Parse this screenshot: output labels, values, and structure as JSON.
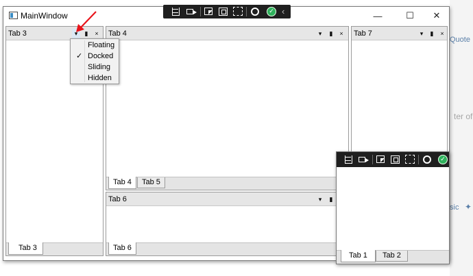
{
  "window": {
    "title": "MainWindow",
    "minimize": "—",
    "maximize": "☐",
    "close": "✕"
  },
  "background": {
    "text_quote": "Quote",
    "text_ter_of": "ter of",
    "text_sic": "sic"
  },
  "panes": {
    "left": {
      "title": "Tab 3",
      "tabs": [
        "Tab 3"
      ]
    },
    "center_top": {
      "title": "Tab 4",
      "tabs": [
        "Tab 4",
        "Tab 5"
      ]
    },
    "center_bottom": {
      "title": "Tab 6",
      "tabs": [
        "Tab 6"
      ]
    },
    "right": {
      "title": "Tab 7"
    },
    "floating": {
      "tabs": [
        "Tab 1",
        "Tab 2"
      ]
    }
  },
  "pane_buttons": {
    "dropdown": "▾",
    "pin": "📌",
    "close": "×"
  },
  "context_menu": {
    "items": [
      {
        "label": "Floating",
        "checked": false
      },
      {
        "label": "Docked",
        "checked": true
      },
      {
        "label": "Sliding",
        "checked": false
      },
      {
        "label": "Hidden",
        "checked": false
      }
    ],
    "check_glyph": "✓"
  },
  "debug_toolbar": {
    "icons": [
      "select-element-icon",
      "video-capture-icon",
      "select-cursor-icon",
      "display-layout-icon",
      "track-focus-icon",
      "hot-reload-icon",
      "check-status-icon",
      "collapse-chevron-icon"
    ],
    "chevron": "‹",
    "check": "✓"
  },
  "colors": {
    "accent_arrow": "#e8141b",
    "status_ok": "#2fb15c",
    "toolbar_bg": "#1f1f1f"
  }
}
